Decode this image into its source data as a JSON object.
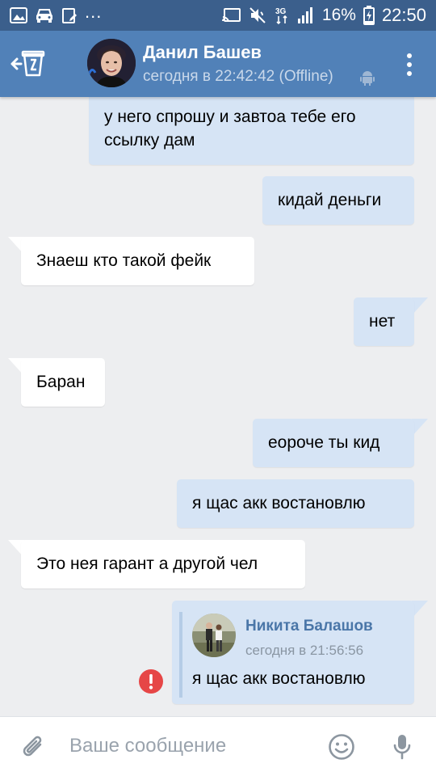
{
  "status_bar": {
    "icons_left": [
      "image-icon",
      "car-icon",
      "clipboard-icon"
    ],
    "more": "...",
    "icons_right": [
      "cast-icon",
      "mute-icon",
      "signal-3g-icon",
      "signal-bars-icon"
    ],
    "network": "3G",
    "battery": "16%",
    "time": "22:50"
  },
  "header": {
    "contact_name": "Данил Башев",
    "status": "сегодня в 22:42:42 (Offline)"
  },
  "messages": [
    {
      "dir": "out",
      "text_lines": [
        "у него спрошу и завтоа тебе его",
        "ссылку дам"
      ]
    },
    {
      "dir": "out",
      "text": "кидай деньги"
    },
    {
      "dir": "in",
      "text": "Знаеш кто такой фейк"
    },
    {
      "dir": "out",
      "text": "нет"
    },
    {
      "dir": "in",
      "text": "Баран"
    },
    {
      "dir": "out",
      "text": "eороче ты кид"
    },
    {
      "dir": "out",
      "text": "я щас акк востановлю"
    },
    {
      "dir": "in",
      "text": "Это нея гарант а другой чел"
    },
    {
      "dir": "out",
      "forwarded": {
        "author": "Никита Балашов",
        "date": "сегодня в 21:56:56",
        "text": "я щас акк востановлю"
      },
      "status": "error"
    }
  ],
  "input": {
    "placeholder": "Ваше сообщение",
    "value": ""
  },
  "colors": {
    "status_bar": "#3b5f8c",
    "header": "#5181b8",
    "background": "#edeef0",
    "bubble_out": "#d6e4f5",
    "bubble_in": "#ffffff",
    "error": "#e64646"
  }
}
